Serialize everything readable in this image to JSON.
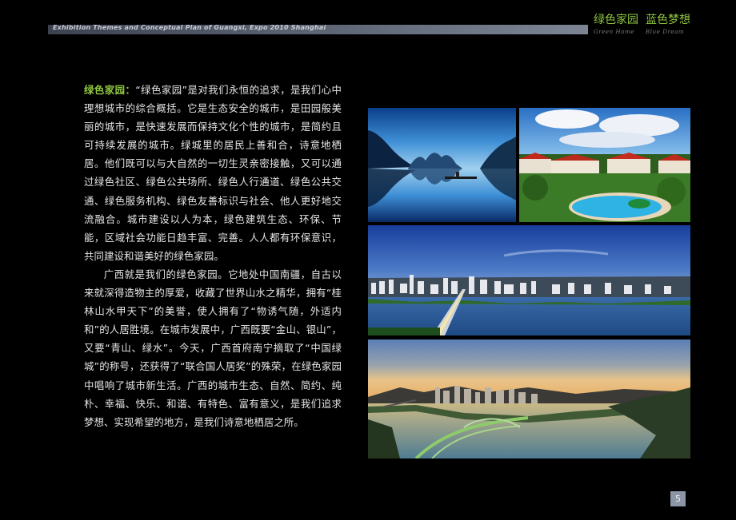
{
  "header": {
    "subtitle": "Exhibition Themes and Conceptual Plan of Guangxi, Expo 2010 Shanghai",
    "brand_left_cn": "绿色家园",
    "brand_left_en": "Green Home",
    "brand_right_cn": "蓝色梦想",
    "brand_right_en": "Blue Dream"
  },
  "body": {
    "lead": "绿色家园：",
    "paragraph1": "“绿色家园”是对我们永恒的追求，是我们心中理想城市的综合概括。它是生态安全的城市，是田园般美丽的城市，是快速发展而保持文化个性的城市，是简约且可持续发展的城市。绿城里的居民上善和合，诗意地栖居。他们既可以与大自然的一切生灵亲密接触，又可以通过绿色社区、绿色公共场所、绿色人行通道、绿色公共交通、绿色服务机构、绿色友善标识与社会、他人更好地交流融合。城市建设以人为本，绿色建筑生态、环保、节能，区域社会功能日趋丰富、完善。人人都有环保意识，共同建设和谐美好的绿色家园。",
    "paragraph2": "广西就是我们的绿色家园。它地处中国南疆，自古以来就深得造物主的厚爱，收藏了世界山水之精华，拥有“桂林山水甲天下”的美誉，使人拥有了“物诱气随，外适内和”的人居胜境。在城市发展中，广西既要“金山、银山”，又要“青山、绿水”。今天，广西首府南宁摘取了“中国绿城”的称号，还获得了“联合国人居奖”的殊荣，在绿色家园中唱响了城市新生活。广西的城市生态、自然、简约、纯朴、幸福、快乐、和谐、有特色、富有意义，是我们追求梦想、实现希望的地方，是我们诗意地栖居之所。"
  },
  "page_number": "5",
  "colors": {
    "accent_green": "#8ec63f",
    "background": "#000000",
    "text": "#e6e6e6"
  }
}
